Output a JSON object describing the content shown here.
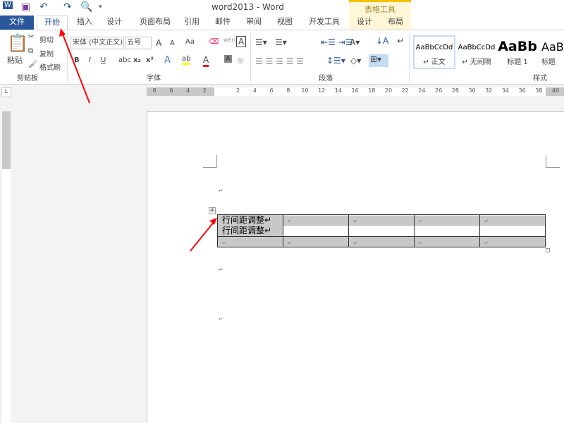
{
  "window": {
    "title": "word2013 - Word"
  },
  "tabs": {
    "file": "文件",
    "home": "开始",
    "insert": "插入",
    "design": "设计",
    "layout": "页面布局",
    "references": "引用",
    "mailings": "邮件",
    "review": "审阅",
    "view": "视图",
    "developer": "开发工具",
    "table_tools": "表格工具",
    "table_design": "设计",
    "table_layout": "布局"
  },
  "clipboard": {
    "paste": "粘贴",
    "cut": "剪切",
    "copy": "复制",
    "format_painter": "格式刷",
    "group": "剪贴板"
  },
  "font": {
    "name": "宋体 (中文正文)",
    "size": "五号",
    "group": "字体",
    "grow": "A",
    "shrink": "A",
    "case": "Aa",
    "bold": "B",
    "italic": "I",
    "underline": "U",
    "strike": "abc",
    "sub": "x₂",
    "sup": "x²",
    "phonetic": "wén"
  },
  "paragraph": {
    "group": "段落"
  },
  "styles": {
    "group": "样式",
    "items": [
      {
        "preview": "AaBbCcDd",
        "name": "↵ 正文"
      },
      {
        "preview": "AaBbCcDd",
        "name": "↵ 无间隔"
      },
      {
        "preview": "AaBb",
        "name": "标题 1"
      },
      {
        "preview": "AaB",
        "name": "标题"
      }
    ]
  },
  "ruler": {
    "labels": [
      8,
      6,
      4,
      2,
      2,
      4,
      6,
      8,
      10,
      12,
      14,
      16,
      18,
      20,
      22,
      24,
      26,
      28,
      30,
      32,
      34,
      36,
      38,
      40
    ],
    "signs": [
      -8,
      -6,
      -4,
      -2,
      2,
      4,
      6,
      8,
      10,
      12,
      14,
      16,
      18,
      20,
      22,
      24,
      26,
      28,
      30,
      32,
      34,
      36,
      38,
      40
    ]
  },
  "document": {
    "mark": "↵",
    "table": {
      "rows": [
        [
          "行间距调整↵\n行间距调整↵",
          "↵",
          "↵",
          "↵",
          "↵"
        ],
        [
          "↵",
          "↵",
          "↵",
          "↵",
          "↵"
        ]
      ]
    }
  },
  "colors": {
    "file_tab": "#2b579a",
    "annotation_arrow": "#ff0000",
    "table_tools": "#f3c300"
  }
}
